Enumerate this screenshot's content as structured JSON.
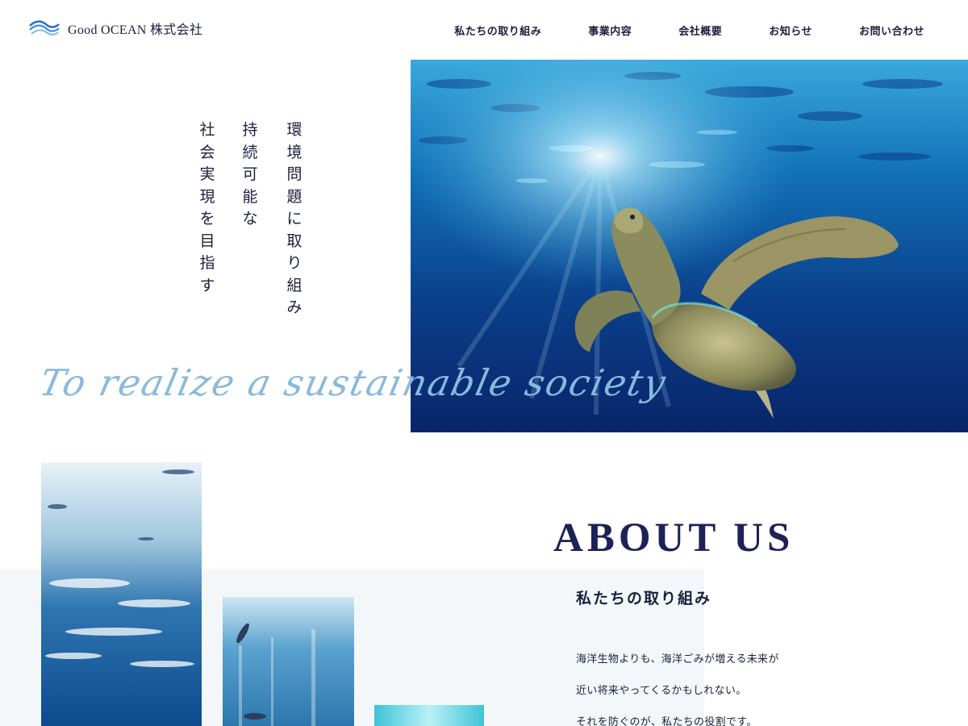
{
  "header": {
    "company_name": "Good OCEAN 株式会社",
    "logo_icon": "wave-logo-icon",
    "nav": [
      {
        "label": "私たちの取り組み"
      },
      {
        "label": "事業内容"
      },
      {
        "label": "会社概要"
      },
      {
        "label": "お知らせ"
      },
      {
        "label": "お問い合わせ"
      }
    ]
  },
  "hero": {
    "vertical_lines": [
      "環境問題に取り組み",
      "持続可能な",
      "社会実現を目指す"
    ],
    "tagline": "To realize a sustainable society",
    "image": "sea-turtle-underwater-photo"
  },
  "about": {
    "heading": "ABOUT US",
    "subheading": "私たちの取り組み",
    "paragraphs": [
      "海洋生物よりも、海洋ごみが増える未来が",
      "近い将来やってくるかもしれない。",
      "それを防ぐのが、私たちの役割です。"
    ],
    "images": [
      "ocean-surface-photo",
      "fish-underwater-photo",
      "light-water-photo"
    ]
  },
  "colors": {
    "navy": "#1c2158",
    "tagline_blue": "#8ab9dc",
    "pale_band": "#f4f7fa"
  }
}
